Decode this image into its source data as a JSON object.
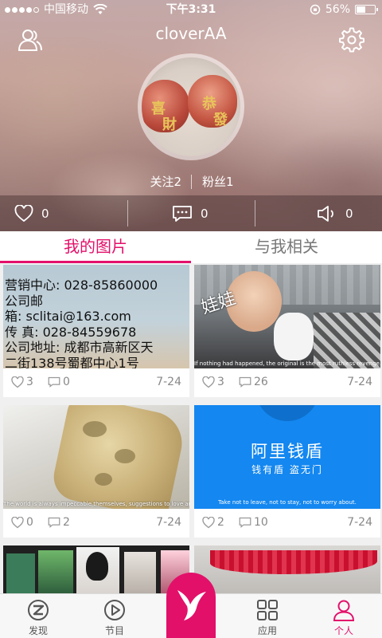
{
  "status_bar": {
    "carrier": "中国移动",
    "time": "下午3:31",
    "battery": "56%",
    "battery_level": 0.56
  },
  "header": {
    "username": "cloverAA",
    "following": "关注2",
    "followers": "粉丝1",
    "avatar_text": [
      "喜",
      "財",
      "恭",
      "發"
    ]
  },
  "stats": {
    "likes": "0",
    "comments": "0",
    "shares": "0"
  },
  "tabs": [
    "我的图片",
    "与我相关"
  ],
  "cards": [
    {
      "likes": "3",
      "comments": "0",
      "date": "7-24",
      "lines": [
        "营销中心: 028-85860000",
        "公司邮",
        "箱: sclitai@163.com",
        "传    真: 028-84559678",
        "公司地址: 成都市高新区天",
        "二街138号蜀都中心1号"
      ]
    },
    {
      "likes": "3",
      "comments": "26",
      "date": "7-24",
      "overlay": "娃娃",
      "caption": "If nothing had happened, the original is the most ruthless revenge."
    },
    {
      "likes": "0",
      "comments": "2",
      "date": "7-24",
      "caption": "The world is always impeccable themselves, suggestions to love are ... Teeth."
    },
    {
      "likes": "2",
      "comments": "10",
      "date": "7-24",
      "brand": "阿里钱盾",
      "slogan": "钱有盾  盗无门",
      "caption": "Take not to leave, not to stay, not to worry about."
    }
  ],
  "bottom_nav": [
    "发现",
    "节目",
    "应用",
    "个人"
  ],
  "colors": {
    "accent": "#e3106a",
    "ali_blue": "#1487f0"
  }
}
